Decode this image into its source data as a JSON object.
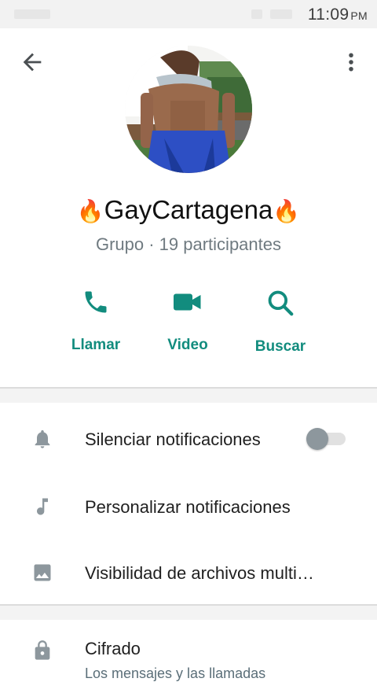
{
  "status_bar": {
    "time": "11:09",
    "ampm": "PM"
  },
  "header": {
    "back_icon": "arrow-left-icon",
    "menu_icon": "more-vert-icon"
  },
  "group": {
    "fire_left": "🔥",
    "name": "GayCartagena",
    "fire_right": "🔥",
    "subtitle": "Grupo · 19 participantes"
  },
  "actions": [
    {
      "label": "Llamar",
      "icon": "phone-icon"
    },
    {
      "label": "Video",
      "icon": "videocam-icon"
    },
    {
      "label": "Buscar",
      "icon": "search-icon"
    }
  ],
  "settings": [
    {
      "label": "Silenciar notificaciones",
      "icon": "bell-icon",
      "toggle": false
    },
    {
      "label": "Personalizar notificaciones",
      "icon": "music-note-icon"
    },
    {
      "label": "Visibilidad de archivos multi…",
      "icon": "image-icon"
    }
  ],
  "encryption": {
    "title": "Cifrado",
    "subtitle": "Los mensajes y las llamadas",
    "icon": "lock-icon"
  },
  "colors": {
    "accent": "#128c7e",
    "icon_gray": "#8d979d",
    "subtle_text": "#6f7a80"
  }
}
